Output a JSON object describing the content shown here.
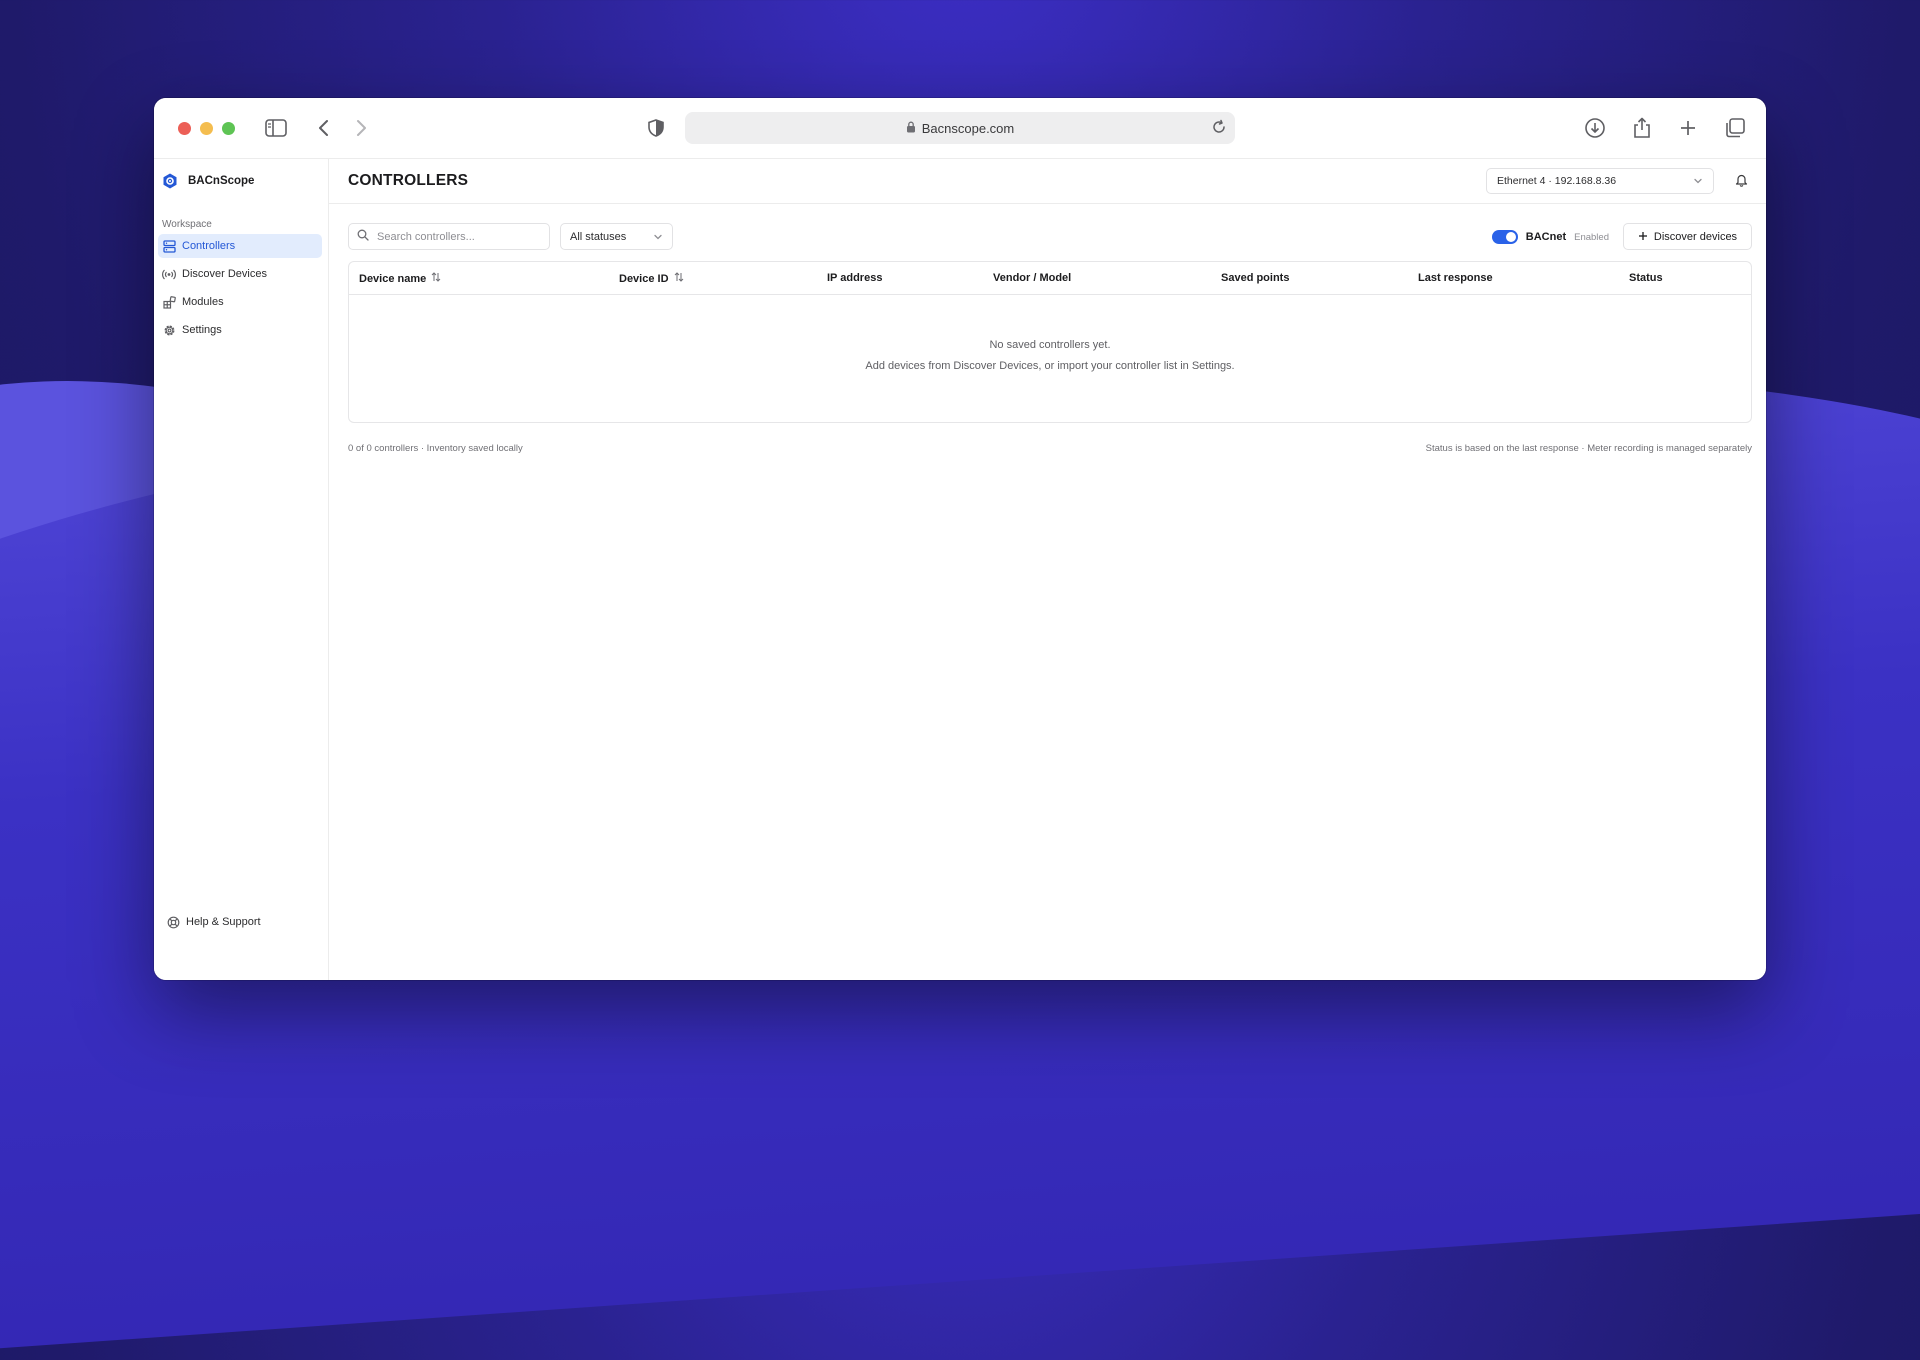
{
  "browser": {
    "url": "Bacnscope.com"
  },
  "app": {
    "brand": "BACnScope",
    "section_label": "Workspace",
    "nav": [
      {
        "label": "Controllers",
        "icon": "server-stack-icon",
        "active": true
      },
      {
        "label": "Discover Devices",
        "icon": "broadcast-icon",
        "active": false
      },
      {
        "label": "Modules",
        "icon": "blocks-icon",
        "active": false
      },
      {
        "label": "Settings",
        "icon": "gear-icon",
        "active": false
      }
    ],
    "help_label": "Help & Support"
  },
  "main": {
    "title": "CONTROLLERS",
    "interface_select": "Ethernet 4 · 192.168.8.36",
    "search_placeholder": "Search controllers...",
    "status_filter": "All statuses",
    "bacnet_label": "BACnet",
    "bacnet_state": "Enabled",
    "discover_button": "Discover devices",
    "table": {
      "columns": [
        "Device name",
        "Device ID",
        "IP address",
        "Vendor / Model",
        "Saved points",
        "Last response",
        "Status"
      ],
      "empty_title": "No saved controllers yet.",
      "empty_hint": "Add devices from Discover Devices, or import your controller list in Settings."
    },
    "footer_left": "0 of 0 controllers · Inventory saved locally",
    "footer_right": "Status is based on the last response · Meter recording is managed separately"
  },
  "colors": {
    "accent": "#2a62e8",
    "active_nav_bg": "#e2ecfd"
  }
}
